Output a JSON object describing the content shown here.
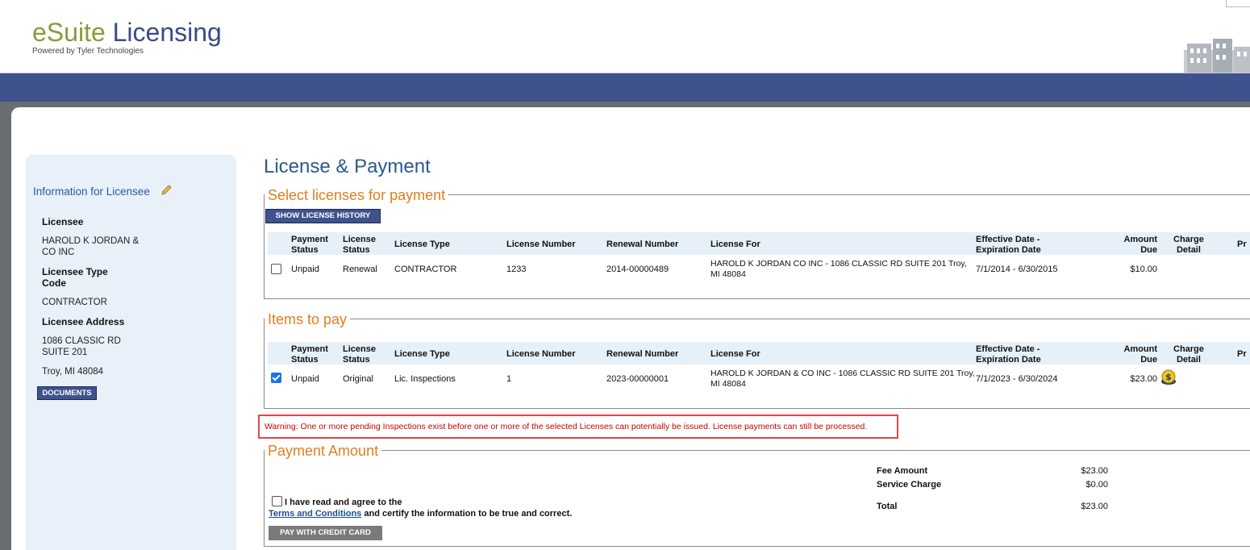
{
  "brand": {
    "part1": "eSuite",
    "part2": " Licensing",
    "powered_by": "Powered by Tyler Technologies"
  },
  "sidebar": {
    "title": "Information for Licensee",
    "licensee_label": "Licensee",
    "licensee_value_line1": "HAROLD K JORDAN &",
    "licensee_value_line2": "CO INC",
    "type_label_line1": "Licensee Type",
    "type_label_line2": "Code",
    "type_value": "CONTRACTOR",
    "address_label": "Licensee Address",
    "address_line1": "1086 CLASSIC RD",
    "address_line2": "SUITE 201",
    "address_line3": "Troy, MI 48084",
    "documents_button": "DOCUMENTS"
  },
  "page_title": "License & Payment",
  "select_section": {
    "legend": "Select licenses for payment",
    "history_button": "SHOW LICENSE HISTORY",
    "headers": {
      "payment_status": [
        "Payment",
        "Status"
      ],
      "license_status": [
        "License",
        "Status"
      ],
      "license_type": "License Type",
      "license_number": "License Number",
      "renewal_number": "Renewal Number",
      "license_for": "License For",
      "dates": [
        "Effective Date -",
        "Expiration Date"
      ],
      "amount": [
        "Amount",
        "Due"
      ],
      "charge": [
        "Charge",
        "Detail"
      ],
      "pr": "Pr"
    },
    "row": {
      "checked": false,
      "payment_status": "Unpaid",
      "license_status": "Renewal",
      "license_type": "CONTRACTOR",
      "license_number": "1233",
      "renewal_number": "2014-00000489",
      "license_for_line1": "HAROLD K JORDAN CO INC - 1086 CLASSIC RD SUITE 201 Troy,",
      "license_for_line2": "MI 48084",
      "dates": "7/1/2014 - 6/30/2015",
      "amount": "$10.00"
    }
  },
  "items_section": {
    "legend": "Items to pay",
    "row": {
      "checked": true,
      "payment_status": "Unpaid",
      "license_status": "Original",
      "license_type": "Lic. Inspections",
      "license_number": "1",
      "renewal_number": "2023-00000001",
      "license_for_line1": "HAROLD K JORDAN & CO INC - 1086 CLASSIC RD SUITE 201 Troy,",
      "license_for_line2": "MI 48084",
      "dates": "7/1/2023 - 6/30/2024",
      "amount": "$23.00",
      "charge_icon": "dollar-coin-icon"
    }
  },
  "warning": "Warning: One or more pending Inspections exist before one or more of the selected Licenses can potentially be issued. License payments can still be processed.",
  "payment": {
    "legend": "Payment Amount",
    "agree_text": "I have read and agree to the",
    "terms_link": "Terms and Conditions",
    "certify_text": " and certify the information to be true and correct.",
    "fee_label": "Fee Amount",
    "fee_value": "$23.00",
    "service_label": "Service Charge",
    "service_value": "$0.00",
    "total_label": "Total",
    "total_value": "$23.00",
    "pay_button": "PAY WITH CREDIT CARD"
  },
  "colors": {
    "nav": "#3f528d",
    "accent_orange": "#e07e1e",
    "warning_red": "#cc0000"
  }
}
